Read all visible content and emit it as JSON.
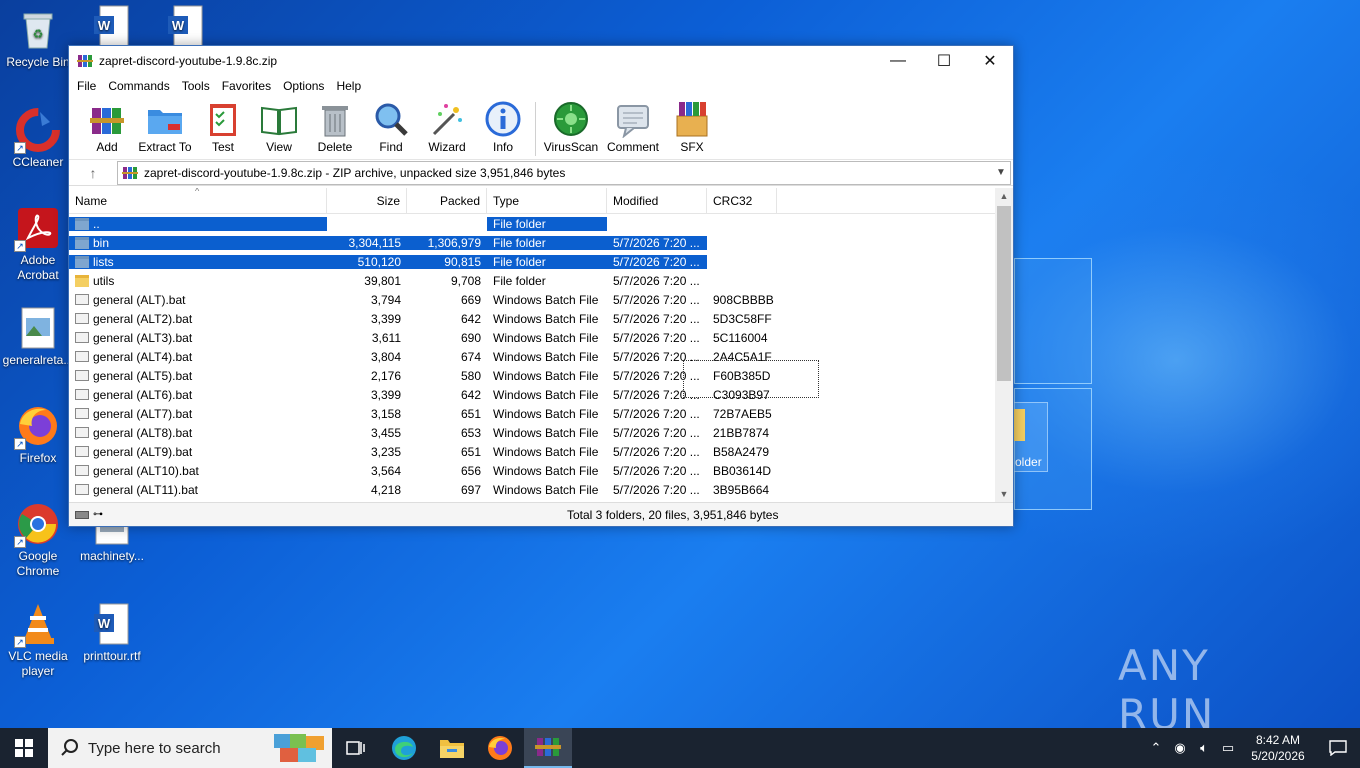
{
  "desktop": {
    "icons": [
      {
        "label": "Recycle Bin",
        "icon": "recycle-bin-icon"
      },
      {
        "label": "CCleaner",
        "icon": "ccleaner-icon"
      },
      {
        "label": "Adobe Acrobat",
        "icon": "adobe-acrobat-icon"
      },
      {
        "label": "generalreta...",
        "icon": "image-file-icon"
      },
      {
        "label": "Firefox",
        "icon": "firefox-icon"
      },
      {
        "label": "Google Chrome",
        "icon": "chrome-icon"
      },
      {
        "label": "machinety...",
        "icon": "image-file-icon"
      },
      {
        "label": "VLC media player",
        "icon": "vlc-icon"
      },
      {
        "label": "printtour.rtf",
        "icon": "word-document-icon"
      },
      {
        "label": "",
        "icon": "word-document-icon"
      },
      {
        "label": "",
        "icon": "word-document-icon"
      }
    ],
    "partial_folder_label": "older",
    "watermark": "ANY RUN"
  },
  "window": {
    "title": "zapret-discord-youtube-1.9.8c.zip",
    "controls": {
      "minimize": "—",
      "maximize": "☐",
      "close": "✕"
    },
    "menu": [
      "File",
      "Commands",
      "Tools",
      "Favorites",
      "Options",
      "Help"
    ],
    "toolbar": [
      {
        "label": "Add",
        "icon": "add-archive-icon"
      },
      {
        "label": "Extract To",
        "icon": "extract-folder-icon"
      },
      {
        "label": "Test",
        "icon": "test-clipboard-icon"
      },
      {
        "label": "View",
        "icon": "view-book-icon"
      },
      {
        "label": "Delete",
        "icon": "trash-can-icon"
      },
      {
        "label": "Find",
        "icon": "magnifier-icon"
      },
      {
        "label": "Wizard",
        "icon": "magic-wand-icon"
      },
      {
        "label": "Info",
        "icon": "info-icon"
      },
      {
        "label": "VirusScan",
        "icon": "virus-scan-icon"
      },
      {
        "label": "Comment",
        "icon": "comment-icon"
      },
      {
        "label": "SFX",
        "icon": "sfx-box-icon"
      }
    ],
    "address": "zapret-discord-youtube-1.9.8c.zip - ZIP archive, unpacked size 3,951,846 bytes",
    "columns": [
      "Name",
      "Size",
      "Packed",
      "Type",
      "Modified",
      "CRC32"
    ],
    "rows": [
      {
        "name": "..",
        "size": "",
        "packed": "",
        "type": "File folder",
        "modified": "",
        "crc": "",
        "kind": "folder",
        "selected": true
      },
      {
        "name": "bin",
        "size": "3,304,115",
        "packed": "1,306,979",
        "type": "File folder",
        "modified": "5/7/2026 7:20 ...",
        "crc": "",
        "kind": "folder",
        "selected": true
      },
      {
        "name": "lists",
        "size": "510,120",
        "packed": "90,815",
        "type": "File folder",
        "modified": "5/7/2026 7:20 ...",
        "crc": "",
        "kind": "folder",
        "selected": true
      },
      {
        "name": "utils",
        "size": "39,801",
        "packed": "9,708",
        "type": "File folder",
        "modified": "5/7/2026 7:20 ...",
        "crc": "",
        "kind": "folder",
        "selected": false
      },
      {
        "name": "general (ALT).bat",
        "size": "3,794",
        "packed": "669",
        "type": "Windows Batch File",
        "modified": "5/7/2026 7:20 ...",
        "crc": "908CBBBB",
        "kind": "bat",
        "selected": false
      },
      {
        "name": "general (ALT2).bat",
        "size": "3,399",
        "packed": "642",
        "type": "Windows Batch File",
        "modified": "5/7/2026 7:20 ...",
        "crc": "5D3C58FF",
        "kind": "bat",
        "selected": false
      },
      {
        "name": "general (ALT3).bat",
        "size": "3,611",
        "packed": "690",
        "type": "Windows Batch File",
        "modified": "5/7/2026 7:20 ...",
        "crc": "5C116004",
        "kind": "bat",
        "selected": false
      },
      {
        "name": "general (ALT4).bat",
        "size": "3,804",
        "packed": "674",
        "type": "Windows Batch File",
        "modified": "5/7/2026 7:20 ...",
        "crc": "2A4C5A1F",
        "kind": "bat",
        "selected": false
      },
      {
        "name": "general (ALT5).bat",
        "size": "2,176",
        "packed": "580",
        "type": "Windows Batch File",
        "modified": "5/7/2026 7:20 ...",
        "crc": "F60B385D",
        "kind": "bat",
        "selected": false
      },
      {
        "name": "general (ALT6).bat",
        "size": "3,399",
        "packed": "642",
        "type": "Windows Batch File",
        "modified": "5/7/2026 7:20 ...",
        "crc": "C3093B97",
        "kind": "bat",
        "selected": false
      },
      {
        "name": "general (ALT7).bat",
        "size": "3,158",
        "packed": "651",
        "type": "Windows Batch File",
        "modified": "5/7/2026 7:20 ...",
        "crc": "72B7AEB5",
        "kind": "bat",
        "selected": false
      },
      {
        "name": "general (ALT8).bat",
        "size": "3,455",
        "packed": "653",
        "type": "Windows Batch File",
        "modified": "5/7/2026 7:20 ...",
        "crc": "21BB7874",
        "kind": "bat",
        "selected": false
      },
      {
        "name": "general (ALT9).bat",
        "size": "3,235",
        "packed": "651",
        "type": "Windows Batch File",
        "modified": "5/7/2026 7:20 ...",
        "crc": "B58A2479",
        "kind": "bat",
        "selected": false
      },
      {
        "name": "general (ALT10).bat",
        "size": "3,564",
        "packed": "656",
        "type": "Windows Batch File",
        "modified": "5/7/2026 7:20 ...",
        "crc": "BB03614D",
        "kind": "bat",
        "selected": false
      },
      {
        "name": "general (ALT11).bat",
        "size": "4,218",
        "packed": "697",
        "type": "Windows Batch File",
        "modified": "5/7/2026 7:20 ...",
        "crc": "3B95B664",
        "kind": "bat",
        "selected": false
      }
    ],
    "status": "Total 3 folders, 20 files, 3,951,846 bytes"
  },
  "taskbar": {
    "search_placeholder": "Type here to search",
    "apps": [
      "task-view-icon",
      "edge-icon",
      "file-explorer-icon",
      "firefox-icon",
      "winrar-icon"
    ],
    "time": "8:42 AM",
    "date": "5/20/2026"
  },
  "colors": {
    "selection": "#0b5fcf",
    "taskbar": "#1a2330"
  }
}
